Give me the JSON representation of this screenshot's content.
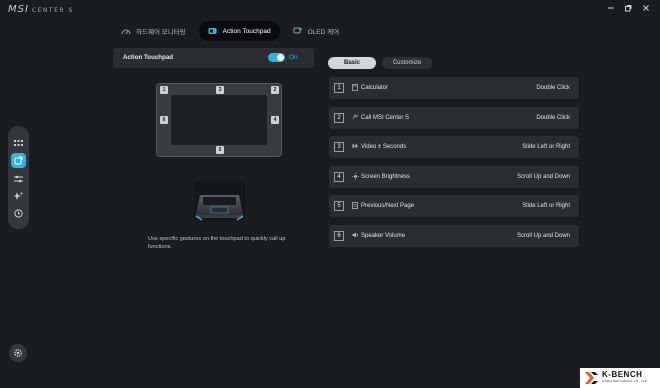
{
  "app": {
    "logo_text": "MSI",
    "logo_sub": "CENTER S",
    "brand_accent": "#29b3e6",
    "window_controls": [
      "minimize-icon",
      "restore-icon",
      "close-icon"
    ]
  },
  "tabs": [
    {
      "label": "하드웨어 모니터링",
      "icon": "speedometer-icon",
      "active": false
    },
    {
      "label": "Action Touchpad",
      "icon": "touchpad-icon",
      "active": true
    },
    {
      "label": "OLED 케어",
      "icon": "oled-care-icon",
      "active": false
    }
  ],
  "rail": [
    "grid-icon",
    "touchpad-icon",
    "sliders-icon",
    "sparkle-icon",
    "history-icon"
  ],
  "settings_icon": "gear-icon",
  "action_touchpad": {
    "label": "Action Touchpad",
    "state": "On"
  },
  "touchpad_zones": [
    "1",
    "2",
    "3",
    "4",
    "5",
    "6"
  ],
  "description": "Use specific gestures on the touchpad to quickly call up functions.",
  "segments": {
    "basic": "Basic",
    "customize": "Customize"
  },
  "gestures": [
    {
      "num": "1",
      "icon": "calculator-icon",
      "name": "Calculator",
      "action": "Double Click"
    },
    {
      "num": "2",
      "icon": "msi-icon",
      "name": "Call MSI Center S",
      "action": "Double Click"
    },
    {
      "num": "3",
      "icon": "skip-icon",
      "name": "Video ± Seconds",
      "action": "Slide Left or Right"
    },
    {
      "num": "4",
      "icon": "brightness-icon",
      "name": "Screen Brightness",
      "action": "Scroll Up and Down"
    },
    {
      "num": "5",
      "icon": "page-icon",
      "name": "Previous/Next Page",
      "action": "Slide Left or Right"
    },
    {
      "num": "6",
      "icon": "speaker-icon",
      "name": "Speaker Volume",
      "action": "Scroll Up and Down"
    }
  ],
  "watermark": {
    "text": "K-BENCH",
    "sub": "KOREA BENCHMARK CO., LTD."
  }
}
